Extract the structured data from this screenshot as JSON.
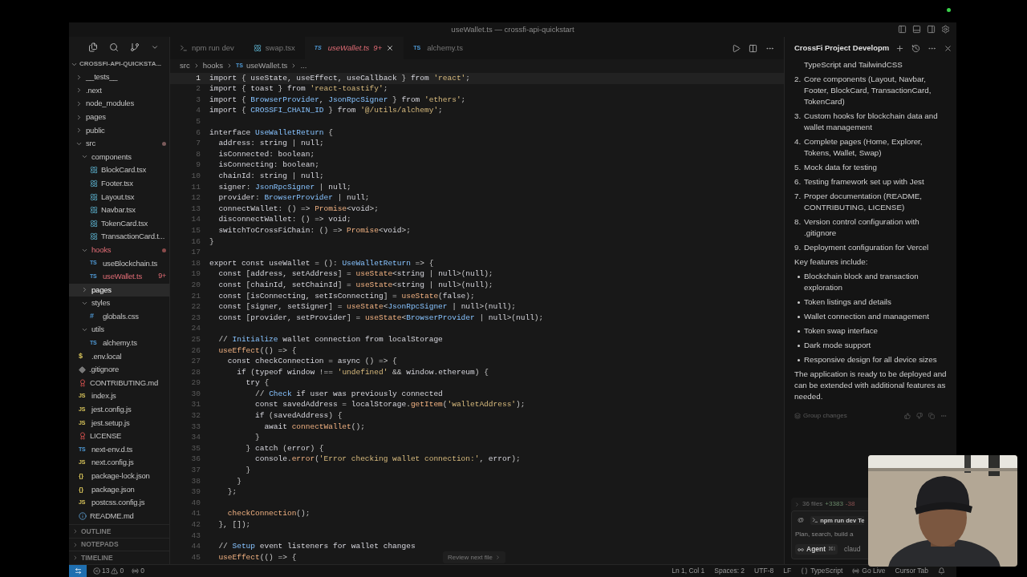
{
  "window": {
    "title": "useWallet.ts — crossfi-api-quickstart"
  },
  "explorer": {
    "title": "CROSSFI-API-QUICKSTA...",
    "items": [
      {
        "name": "__tests__",
        "kind": "folder",
        "expanded": false,
        "selected": false
      },
      {
        "name": ".next",
        "kind": "folder",
        "expanded": false,
        "selected": false
      },
      {
        "name": "node_modules",
        "kind": "folder",
        "expanded": false,
        "selected": false
      },
      {
        "name": "pages",
        "kind": "folder",
        "expanded": false,
        "selected": false
      },
      {
        "name": "public",
        "kind": "folder",
        "expanded": false,
        "selected": false
      },
      {
        "name": "src",
        "kind": "folder",
        "expanded": true,
        "selected": false,
        "modified": true,
        "children": [
          {
            "name": "components",
            "kind": "folder",
            "expanded": true,
            "selected": false,
            "children": [
              {
                "name": "BlockCard.tsx",
                "kind": "react",
                "selected": false
              },
              {
                "name": "Footer.tsx",
                "kind": "react",
                "selected": false
              },
              {
                "name": "Layout.tsx",
                "kind": "react",
                "selected": false
              },
              {
                "name": "Navbar.tsx",
                "kind": "react",
                "selected": false
              },
              {
                "name": "TokenCard.tsx",
                "kind": "react",
                "selected": false
              },
              {
                "name": "TransactionCard.t...",
                "kind": "react",
                "selected": false
              }
            ]
          },
          {
            "name": "hooks",
            "kind": "folder",
            "expanded": true,
            "selected": false,
            "error": true,
            "children": [
              {
                "name": "useBlockchain.ts",
                "kind": "ts",
                "badge": "TS",
                "selected": false,
                "error": false
              },
              {
                "name": "useWallet.ts",
                "kind": "ts",
                "badge": "TS",
                "selected": false,
                "error": true,
                "problems": "9+"
              }
            ]
          },
          {
            "name": "pages",
            "kind": "folder",
            "expanded": false,
            "selected": true
          },
          {
            "name": "styles",
            "kind": "folder",
            "expanded": true,
            "selected": false,
            "children": [
              {
                "name": "globals.css",
                "kind": "css",
                "badge": "#",
                "selected": false
              }
            ]
          },
          {
            "name": "utils",
            "kind": "folder",
            "expanded": true,
            "selected": false,
            "children": [
              {
                "name": "alchemy.ts",
                "kind": "ts",
                "badge": "TS",
                "selected": false
              }
            ]
          }
        ]
      },
      {
        "name": ".env.local",
        "kind": "env",
        "badge": "$",
        "selected": false
      },
      {
        "name": ".gitignore",
        "kind": "git",
        "selected": false
      },
      {
        "name": "CONTRIBUTING.md",
        "kind": "ribbon",
        "selected": false
      },
      {
        "name": "index.js",
        "kind": "js",
        "badge": "JS",
        "selected": false
      },
      {
        "name": "jest.config.js",
        "kind": "js",
        "badge": "JS",
        "selected": false
      },
      {
        "name": "jest.setup.js",
        "kind": "js",
        "badge": "JS",
        "selected": false
      },
      {
        "name": "LICENSE",
        "kind": "ribbon",
        "selected": false
      },
      {
        "name": "next-env.d.ts",
        "kind": "ts",
        "badge": "TS",
        "selected": false
      },
      {
        "name": "next.config.js",
        "kind": "js",
        "badge": "JS",
        "selected": false
      },
      {
        "name": "package-lock.json",
        "kind": "json",
        "badge": "{}",
        "selected": false
      },
      {
        "name": "package.json",
        "kind": "json",
        "badge": "{}",
        "selected": false
      },
      {
        "name": "postcss.config.js",
        "kind": "js",
        "badge": "JS",
        "selected": false
      },
      {
        "name": "README.md",
        "kind": "info",
        "selected": false
      }
    ],
    "sections": [
      "OUTLINE",
      "NOTEPADS",
      "TIMELINE"
    ]
  },
  "tabs": [
    {
      "label": "npm run dev",
      "kind": "terminal",
      "selected": false
    },
    {
      "label": "swap.tsx",
      "kind": "react",
      "selected": false
    },
    {
      "label": "useWallet.ts",
      "kind": "ts",
      "badge": "TS",
      "problems": "9+",
      "selected": true
    },
    {
      "label": "alchemy.ts",
      "kind": "ts",
      "badge": "TS",
      "selected": false
    }
  ],
  "breadcrumb": {
    "parts": [
      "src",
      "hooks"
    ],
    "badge": "TS",
    "file": "useWallet.ts",
    "more": "..."
  },
  "editor": {
    "lines": [
      {
        "n": "1",
        "active": true,
        "text": "import { useState, useEffect, useCallback } from 'react';"
      },
      {
        "n": "2",
        "active": false,
        "text": "import { toast } from 'react-toastify';"
      },
      {
        "n": "3",
        "active": false,
        "text": "import { BrowserProvider, JsonRpcSigner } from 'ethers';"
      },
      {
        "n": "4",
        "active": false,
        "text": "import { CROSSFI_CHAIN_ID } from '@/utils/alchemy';"
      },
      {
        "n": "5",
        "active": false
      },
      {
        "n": "6",
        "active": false,
        "text": "interface UseWalletReturn {"
      },
      {
        "n": "7",
        "active": false,
        "text": "  address: string | null;"
      },
      {
        "n": "8",
        "active": false,
        "text": "  isConnected: boolean;"
      },
      {
        "n": "9",
        "active": false,
        "text": "  isConnecting: boolean;"
      },
      {
        "n": "10",
        "active": false,
        "text": "  chainId: string | null;"
      },
      {
        "n": "11",
        "active": false,
        "text": "  signer: JsonRpcSigner | null;"
      },
      {
        "n": "12",
        "active": false,
        "text": "  provider: BrowserProvider | null;"
      },
      {
        "n": "13",
        "active": false,
        "text": "  connectWallet: () => Promise<void>;"
      },
      {
        "n": "14",
        "active": false,
        "text": "  disconnectWallet: () => void;"
      },
      {
        "n": "15",
        "active": false,
        "text": "  switchToCrossFiChain: () => Promise<void>;"
      },
      {
        "n": "16",
        "active": false,
        "text": "}"
      },
      {
        "n": "17",
        "active": false
      },
      {
        "n": "18",
        "active": false,
        "text": "export const useWallet = (): UseWalletReturn => {"
      },
      {
        "n": "19",
        "active": false,
        "text": "  const [address, setAddress] = useState<string | null>(null);"
      },
      {
        "n": "20",
        "active": false,
        "text": "  const [chainId, setChainId] = useState<string | null>(null);"
      },
      {
        "n": "21",
        "active": false,
        "text": "  const [isConnecting, setIsConnecting] = useState(false);"
      },
      {
        "n": "22",
        "active": false,
        "text": "  const [signer, setSigner] = useState<JsonRpcSigner | null>(null);"
      },
      {
        "n": "23",
        "active": false,
        "text": "  const [provider, setProvider] = useState<BrowserProvider | null>(null);"
      },
      {
        "n": "24",
        "active": false
      },
      {
        "n": "25",
        "active": false,
        "text": "  // Initialize wallet connection from localStorage"
      },
      {
        "n": "26",
        "active": false,
        "text": "  useEffect(() => {"
      },
      {
        "n": "27",
        "active": false,
        "text": "    const checkConnection = async () => {"
      },
      {
        "n": "28",
        "active": false,
        "text": "      if (typeof window !== 'undefined' && window.ethereum) {"
      },
      {
        "n": "29",
        "active": false,
        "text": "        try {"
      },
      {
        "n": "30",
        "active": false,
        "text": "          // Check if user was previously connected"
      },
      {
        "n": "31",
        "active": false,
        "text": "          const savedAddress = localStorage.getItem('walletAddress');"
      },
      {
        "n": "32",
        "active": false,
        "text": "          if (savedAddress) {"
      },
      {
        "n": "33",
        "active": false,
        "text": "            await connectWallet();"
      },
      {
        "n": "34",
        "active": false,
        "text": "          }"
      },
      {
        "n": "35",
        "active": false,
        "text": "        } catch (error) {"
      },
      {
        "n": "36",
        "active": false,
        "text": "          console.error('Error checking wallet connection:', error);"
      },
      {
        "n": "37",
        "active": false,
        "text": "        }"
      },
      {
        "n": "38",
        "active": false,
        "text": "      }"
      },
      {
        "n": "39",
        "active": false,
        "text": "    };"
      },
      {
        "n": "40",
        "active": false
      },
      {
        "n": "41",
        "active": false,
        "text": "    checkConnection();"
      },
      {
        "n": "42",
        "active": false,
        "text": "  }, []);"
      },
      {
        "n": "43",
        "active": false
      },
      {
        "n": "44",
        "active": false,
        "text": "  // Setup event listeners for wallet changes"
      },
      {
        "n": "45",
        "active": false,
        "text": "  useEffect(() => {"
      }
    ]
  },
  "review_button": {
    "label": "Review next file"
  },
  "chat": {
    "title": "CrossFi Project Developm",
    "blocks": [
      {
        "kind": "item",
        "text": "TypeScript and TailwindCSS"
      },
      {
        "kind": "item",
        "number": "2.",
        "text": "Core components (Layout, Navbar, Footer, BlockCard, TransactionCard, TokenCard)"
      },
      {
        "kind": "item",
        "number": "3.",
        "text": "Custom hooks for blockchain data and wallet management"
      },
      {
        "kind": "item",
        "number": "4.",
        "text": "Complete pages (Home, Explorer, Tokens, Wallet, Swap)"
      },
      {
        "kind": "item",
        "number": "5.",
        "text": "Mock data for testing"
      },
      {
        "kind": "item",
        "number": "6.",
        "text": "Testing framework set up with Jest"
      },
      {
        "kind": "item",
        "number": "7.",
        "text": "Proper documentation (README, CONTRIBUTING, LICENSE)"
      },
      {
        "kind": "item",
        "number": "8.",
        "text": "Version control configuration with .gitignore"
      },
      {
        "kind": "item",
        "number": "9.",
        "text": "Deployment configuration for Vercel"
      },
      {
        "kind": "paragraph",
        "text": "Key features include:"
      },
      {
        "kind": "bullet",
        "text": "Blockchain block and transaction exploration"
      },
      {
        "kind": "bullet",
        "text": "Token listings and details"
      },
      {
        "kind": "bullet",
        "text": "Wallet connection and management"
      },
      {
        "kind": "bullet",
        "text": "Token swap interface"
      },
      {
        "kind": "bullet",
        "text": "Dark mode support"
      },
      {
        "kind": "bullet",
        "text": "Responsive design for all device sizes"
      },
      {
        "kind": "paragraph",
        "text": "The application is ready to be deployed and can be extended with additional features as needed."
      }
    ],
    "group_changes": "Group changes",
    "changes": {
      "files": "36 files",
      "added": "+3383",
      "removed": "-38"
    },
    "context_chips": [
      "@",
      "npm run dev Te"
    ],
    "input": {
      "placeholder": "Plan, search, build a"
    },
    "mode": {
      "label": "Agent",
      "shortcut": "⌘I"
    },
    "model": "claud"
  },
  "status_bar": {
    "errors": "13",
    "warnings": "0",
    "ports": "0",
    "right": [
      "Ln 1, Col 1",
      "Spaces: 2",
      "UTF-8",
      "LF",
      "TypeScript",
      "Go Live",
      "Cursor Tab"
    ]
  }
}
